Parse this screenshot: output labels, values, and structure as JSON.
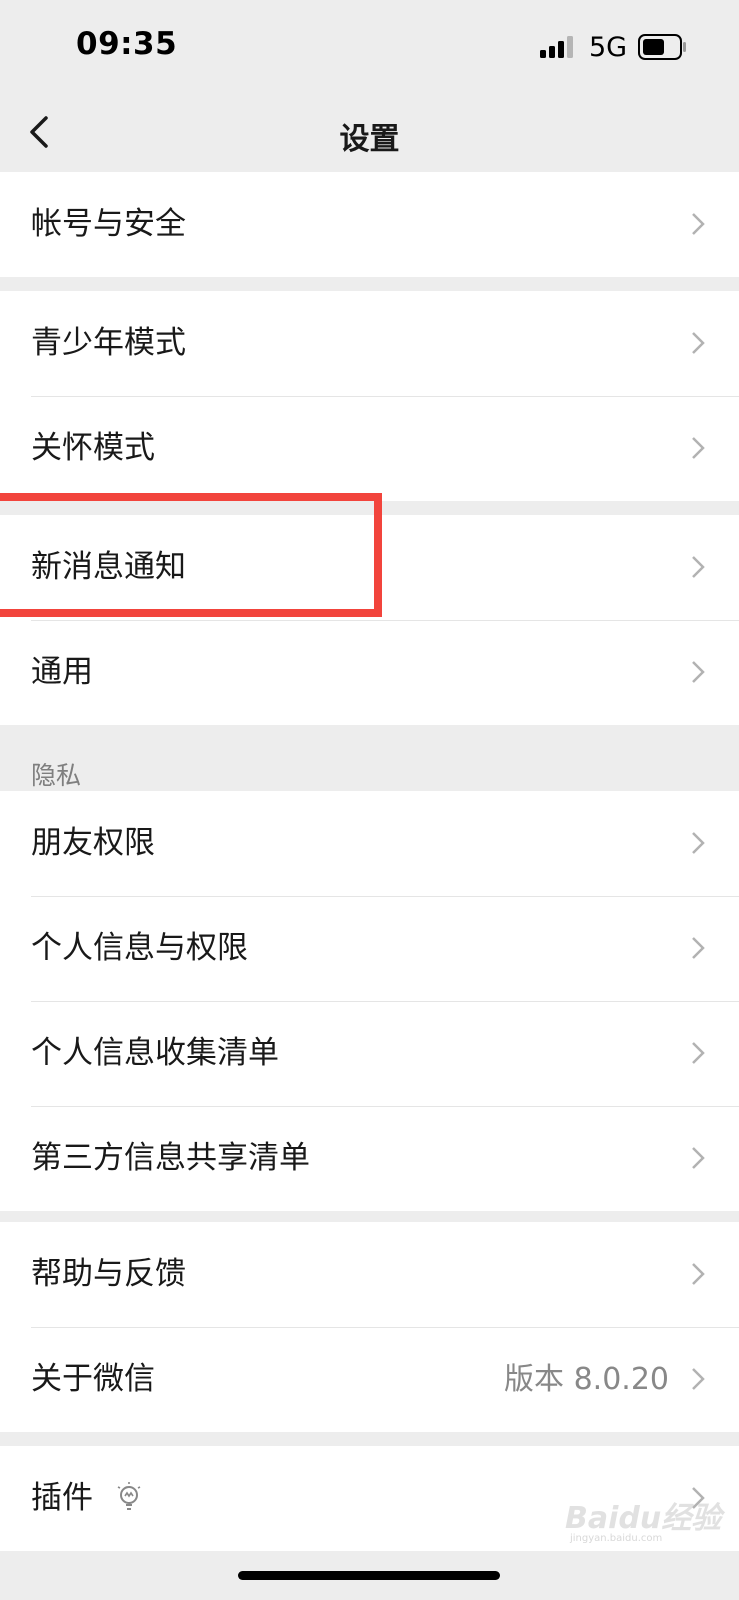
{
  "status_bar": {
    "time": "09:35",
    "network": "5G"
  },
  "nav": {
    "title": "设置"
  },
  "groups": [
    {
      "rows": [
        {
          "label": "帐号与安全"
        }
      ]
    },
    {
      "rows": [
        {
          "label": "青少年模式"
        },
        {
          "label": "关怀模式"
        }
      ]
    },
    {
      "rows": [
        {
          "label": "新消息通知"
        },
        {
          "label": "通用"
        }
      ]
    },
    {
      "section_title": "隐私",
      "rows": [
        {
          "label": "朋友权限"
        },
        {
          "label": "个人信息与权限"
        },
        {
          "label": "个人信息收集清单"
        },
        {
          "label": "第三方信息共享清单"
        }
      ]
    },
    {
      "rows": [
        {
          "label": "帮助与反馈"
        },
        {
          "label": "关于微信",
          "value": "版本 8.0.20"
        }
      ]
    },
    {
      "rows": [
        {
          "label": "插件"
        }
      ]
    }
  ],
  "watermark": {
    "text": "Baidu经验",
    "sub": "jingyan.baidu.com"
  },
  "colors": {
    "highlight": "#f2443c",
    "background": "#ededed",
    "card": "#ffffff"
  }
}
